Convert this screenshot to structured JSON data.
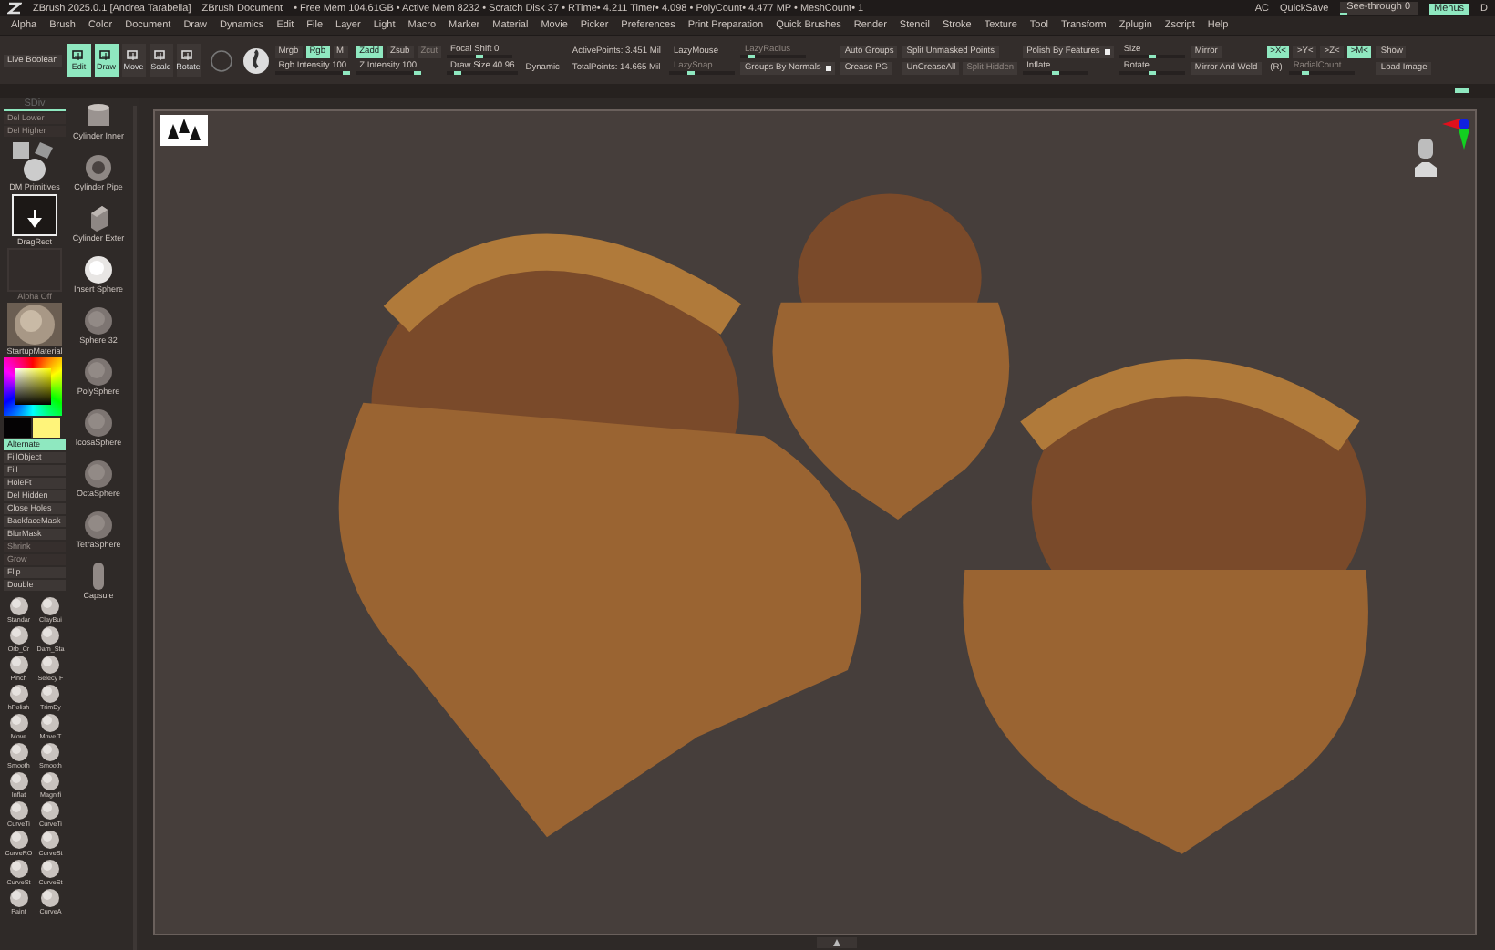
{
  "title_bar": {
    "app": "ZBrush 2025.0.1 [Andrea Tarabella]",
    "document": "ZBrush Document",
    "stats": "• Free Mem 104.61GB • Active Mem 8232 • Scratch Disk 37 • RTime• 4.211 Timer• 4.098 • PolyCount• 4.477 MP • MeshCount• 1",
    "right": [
      {
        "label": "AC",
        "kind": "text"
      },
      {
        "label": "QuickSave",
        "kind": "text"
      },
      {
        "label": "See-through   0",
        "kind": "slider",
        "level": 0.1
      },
      {
        "label": "Menus",
        "kind": "toggle",
        "selected": true
      },
      {
        "label": "D",
        "kind": "text"
      }
    ]
  },
  "menu_bar": [
    "Alpha",
    "Brush",
    "Color",
    "Document",
    "Draw",
    "Dynamics",
    "Edit",
    "File",
    "Layer",
    "Light",
    "Macro",
    "Marker",
    "Material",
    "Movie",
    "Picker",
    "Preferences",
    "Print Preparation",
    "Quick Brushes",
    "Render",
    "Stencil",
    "Stroke",
    "Texture",
    "Tool",
    "Transform",
    "Zplugin",
    "Zscript",
    "Help"
  ],
  "toolbar": [
    {
      "rows": [
        [
          {
            "kind": "button",
            "label": "Live Boolean",
            "disabled": false
          }
        ]
      ]
    },
    {
      "rows": [
        [
          {
            "kind": "tool",
            "label": "Edit",
            "selected": true
          },
          {
            "kind": "tool",
            "label": "Draw",
            "selected": true
          },
          {
            "kind": "tool",
            "label": "Move",
            "selected": false
          },
          {
            "kind": "tool",
            "label": "Scale",
            "selected": false
          },
          {
            "kind": "tool",
            "label": "Rotate",
            "selected": false
          },
          {
            "kind": "dial"
          },
          {
            "kind": "material"
          }
        ]
      ]
    },
    {
      "rows": [
        [
          {
            "kind": "toggle",
            "label": "Mrgb",
            "selected": false
          },
          {
            "kind": "toggle",
            "label": "Rgb",
            "selected": true
          },
          {
            "kind": "toggle",
            "label": "M",
            "selected": false
          }
        ],
        [
          {
            "kind": "slider",
            "label": "Rgb Intensity 100",
            "level": 1,
            "disabled": false
          }
        ]
      ]
    },
    {
      "rows": [
        [
          {
            "kind": "toggle",
            "label": "Zadd",
            "selected": true
          },
          {
            "kind": "toggle",
            "label": "Zsub",
            "selected": false
          },
          {
            "kind": "button",
            "label": "Zcut",
            "disabled": true
          }
        ],
        [
          {
            "kind": "slider",
            "label": "Z Intensity 100",
            "level": 1,
            "disabled": false
          }
        ]
      ]
    },
    {
      "rows": [
        [
          {
            "kind": "slider",
            "label": "Focal Shift 0",
            "level": 0.5,
            "disabled": false
          }
        ],
        [
          {
            "kind": "slider",
            "label": "Draw Size 40.96",
            "level": 0.12,
            "disabled": false
          },
          {
            "kind": "text",
            "label": "Dynamic"
          }
        ]
      ]
    },
    {
      "rows": [
        [
          {
            "kind": "text",
            "label": "ActivePoints: 3.451 Mil"
          }
        ],
        [
          {
            "kind": "text",
            "label": "TotalPoints: 14.665 Mil"
          }
        ]
      ]
    },
    {
      "rows": [
        [
          {
            "kind": "text",
            "label": "LazyMouse"
          }
        ],
        [
          {
            "kind": "slider",
            "label": "LazySnap",
            "level": 0.3,
            "disabled": true
          }
        ]
      ]
    },
    {
      "rows": [
        [
          {
            "kind": "slider",
            "label": "LazyRadius",
            "level": 0.1,
            "disabled": true
          }
        ],
        [
          {
            "kind": "switch",
            "label": "Groups By Normals",
            "on": true
          }
        ]
      ]
    },
    {
      "rows": [
        [
          {
            "kind": "button",
            "label": "Auto Groups",
            "disabled": false
          }
        ],
        [
          {
            "kind": "button",
            "label": "Crease PG",
            "disabled": false
          }
        ]
      ]
    },
    {
      "rows": [
        [
          {
            "kind": "button",
            "label": "Split Unmasked Points",
            "disabled": false
          }
        ],
        [
          {
            "kind": "button",
            "label": "UnCreaseAll",
            "disabled": false
          },
          {
            "kind": "button",
            "label": "Split Hidden",
            "disabled": true
          }
        ]
      ]
    },
    {
      "rows": [
        [
          {
            "kind": "switch",
            "label": "Polish By Features",
            "on": true
          }
        ],
        [
          {
            "kind": "slider",
            "label": "Inflate",
            "level": 0.5,
            "disabled": false
          }
        ]
      ]
    },
    {
      "rows": [
        [
          {
            "kind": "slider",
            "label": "Size",
            "level": 0.5,
            "disabled": false
          }
        ],
        [
          {
            "kind": "slider",
            "label": "Rotate",
            "level": 0.5,
            "disabled": false
          }
        ]
      ]
    },
    {
      "rows": [
        [
          {
            "kind": "button",
            "label": "Mirror",
            "disabled": false
          }
        ],
        [
          {
            "kind": "button",
            "label": "Mirror And Weld",
            "disabled": false
          }
        ]
      ]
    },
    {
      "rows": [
        [
          {
            "kind": "toggle",
            "label": ">X<",
            "selected": true
          },
          {
            "kind": "toggle",
            "label": ">Y<",
            "selected": false
          },
          {
            "kind": "toggle",
            "label": ">Z<",
            "selected": false
          },
          {
            "kind": "toggle",
            "label": ">M<",
            "selected": true
          }
        ],
        [
          {
            "kind": "text",
            "label": "(R)"
          },
          {
            "kind": "slider",
            "label": "RadialCount",
            "level": 0.2,
            "disabled": true
          }
        ]
      ]
    },
    {
      "rows": [
        [
          {
            "kind": "button",
            "label": "Show",
            "disabled": false
          }
        ],
        [
          {
            "kind": "button",
            "label": "Load Image",
            "disabled": false
          }
        ]
      ]
    }
  ],
  "left_panel": {
    "controls": [
      {
        "kind": "slider",
        "label": "SDiv",
        "level": 1
      },
      {
        "kind": "button",
        "label": "Del Lower",
        "disabled": true,
        "selected": false
      },
      {
        "kind": "button",
        "label": "Del Higher",
        "disabled": true,
        "selected": false
      },
      {
        "kind": "primitives",
        "label": "DM Primitives"
      },
      {
        "kind": "stroke",
        "label": "DragRect"
      },
      {
        "kind": "alpha",
        "label": "Alpha Off"
      },
      {
        "kind": "material",
        "label": "StartupMaterial"
      },
      {
        "kind": "picker"
      },
      {
        "kind": "swatches",
        "swatches": [
          {
            "color": "#050304"
          },
          {
            "color": "#fff47a"
          }
        ]
      },
      {
        "kind": "button",
        "label": "Alternate",
        "disabled": false,
        "selected": true
      },
      {
        "kind": "button",
        "label": "FillObject",
        "disabled": false,
        "selected": false
      },
      {
        "kind": "button",
        "label": "Fill",
        "disabled": false,
        "selected": false
      },
      {
        "kind": "button",
        "label": "HoleFt",
        "disabled": false,
        "selected": false
      },
      {
        "kind": "button",
        "label": "Del Hidden",
        "disabled": false,
        "selected": false
      },
      {
        "kind": "button",
        "label": "Close Holes",
        "disabled": false,
        "selected": false
      },
      {
        "kind": "button",
        "label": "BackfaceMask",
        "disabled": false,
        "selected": false
      },
      {
        "kind": "button",
        "label": "BlurMask",
        "disabled": false,
        "selected": false
      },
      {
        "kind": "button",
        "label": "Shrink",
        "disabled": true,
        "selected": false
      },
      {
        "kind": "button",
        "label": "Grow",
        "disabled": true,
        "selected": false
      },
      {
        "kind": "button",
        "label": "Flip",
        "disabled": false,
        "selected": false
      },
      {
        "kind": "button",
        "label": "Double",
        "disabled": false,
        "selected": false
      }
    ],
    "brushes": [
      "Standar",
      "ClayBui",
      "Orb_Cr",
      "Dam_Sta",
      "Pinch",
      "Selecy F",
      "hPolish",
      "TrimDy",
      "Move",
      "Move T",
      "Smooth",
      "Smooth",
      "Inflat",
      "Magnifi",
      "CurveTi",
      "CurveTi",
      "CurveRO",
      "CurveSt",
      "CurveSt",
      "CurveSt",
      "Paint",
      "CurveA"
    ],
    "meshes": [
      {
        "kind": "cylinder",
        "label": "Cylinder Inner"
      },
      {
        "kind": "ring",
        "label": "Cylinder Pipe"
      },
      {
        "kind": "box",
        "label": "Cylinder Exter"
      },
      {
        "kind": "bright",
        "label": "Insert Sphere"
      },
      {
        "kind": "sphere",
        "label": "Sphere 32"
      },
      {
        "kind": "sphere",
        "label": "PolySphere"
      },
      {
        "kind": "sphere",
        "label": "IcosaSphere"
      },
      {
        "kind": "sphere",
        "label": "OctaSphere"
      },
      {
        "kind": "sphere",
        "label": "TetraSphere"
      },
      {
        "kind": "capsule",
        "label": "Capsule"
      }
    ]
  }
}
